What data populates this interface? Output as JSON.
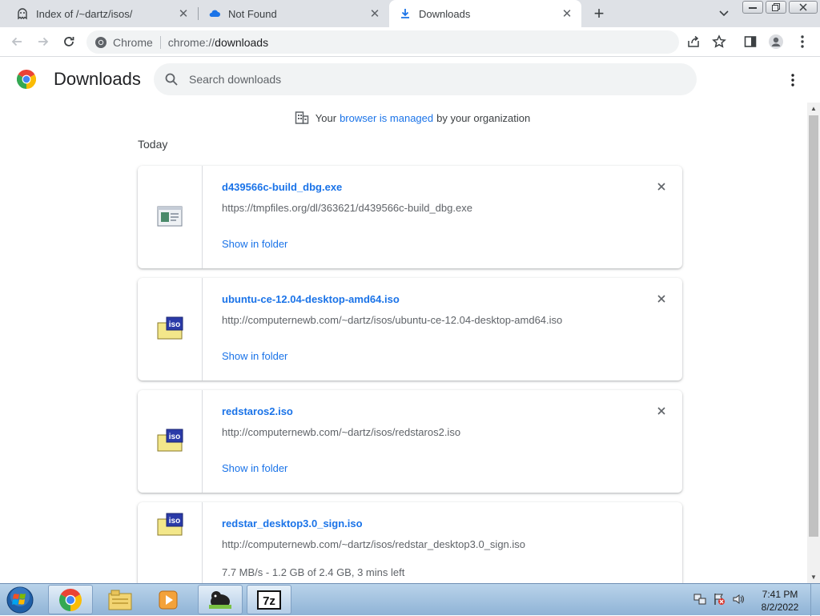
{
  "tabs": [
    {
      "label": "Index of /~dartz/isos/",
      "icon": "ghost-icon"
    },
    {
      "label": "Not Found",
      "icon": "cloud-icon"
    },
    {
      "label": "Downloads",
      "icon": "download-icon"
    }
  ],
  "omnibox": {
    "chip": "Chrome",
    "url_scheme": "chrome://",
    "url_path": "downloads"
  },
  "page": {
    "title": "Downloads",
    "search_placeholder": "Search downloads"
  },
  "managed": {
    "before": "Your",
    "link": "browser is managed",
    "after": "by your organization"
  },
  "section_date": "Today",
  "downloads": [
    {
      "name": "d439566c-build_dbg.exe",
      "url": "https://tmpfiles.org/dl/363621/d439566c-build_dbg.exe",
      "action": "Show in folder",
      "icon": "exe-file-icon"
    },
    {
      "name": "ubuntu-ce-12.04-desktop-amd64.iso",
      "url": "http://computernewb.com/~dartz/isos/ubuntu-ce-12.04-desktop-amd64.iso",
      "action": "Show in folder",
      "icon": "iso-file-icon"
    },
    {
      "name": "redstaros2.iso",
      "url": "http://computernewb.com/~dartz/isos/redstaros2.iso",
      "action": "Show in folder",
      "icon": "iso-file-icon"
    },
    {
      "name": "redstar_desktop3.0_sign.iso",
      "url": "http://computernewb.com/~dartz/isos/redstar_desktop3.0_sign.iso",
      "status": "7.7 MB/s - 1.2 GB of 2.4 GB, 3 mins left",
      "icon": "iso-file-icon"
    }
  ],
  "taskbar": {
    "time": "7:41 PM",
    "date": "8/2/2022"
  },
  "colors": {
    "accent": "#1a73e8",
    "tab_strip": "#dee1e6",
    "taskbar": "#a9c6e2"
  }
}
